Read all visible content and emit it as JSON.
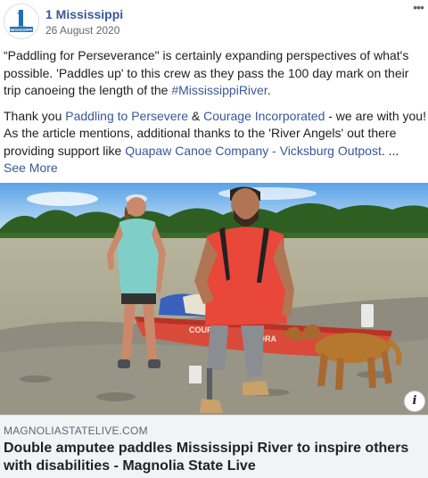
{
  "header": {
    "page_name": "1 Mississippi",
    "date": "26 August 2020",
    "avatar_text": "MISSISSIPPI",
    "menu_icon": "more-horizontal-icon"
  },
  "post": {
    "p1_text": "“Paddling for Perseverance\" is certainly expanding perspectives of what's possible. 'Paddles up' to this crew as they pass the 100 day mark on their trip canoeing the length of the ",
    "p1_hashtag": "#MississippiRiver",
    "p1_end": ".",
    "p2_thanks": "Thank you ",
    "p2_link1": "Paddling to Persevere",
    "p2_amp": " & ",
    "p2_link2": "Courage Incorporated",
    "p2_mid": " - we are with you! As the article mentions, additional thanks to the 'River Angels' out there providing support like ",
    "p2_link3": "Quapaw Canoe Company - Vicksburg Outpost",
    "p2_ellipsis": ". ...",
    "see_more": "See More"
  },
  "media": {
    "canoe_text": "COURA",
    "canoe_text2": "ORA",
    "info_icon": "info-icon"
  },
  "link_preview": {
    "domain": "MAGNOLIASTATELIVE.COM",
    "title": "Double amputee paddles Mississippi River to inspire others with disabilities - Magnolia State Live"
  },
  "colors": {
    "link": "#385898",
    "secondary_text": "#606770",
    "preview_bg": "#f2f3f5"
  }
}
